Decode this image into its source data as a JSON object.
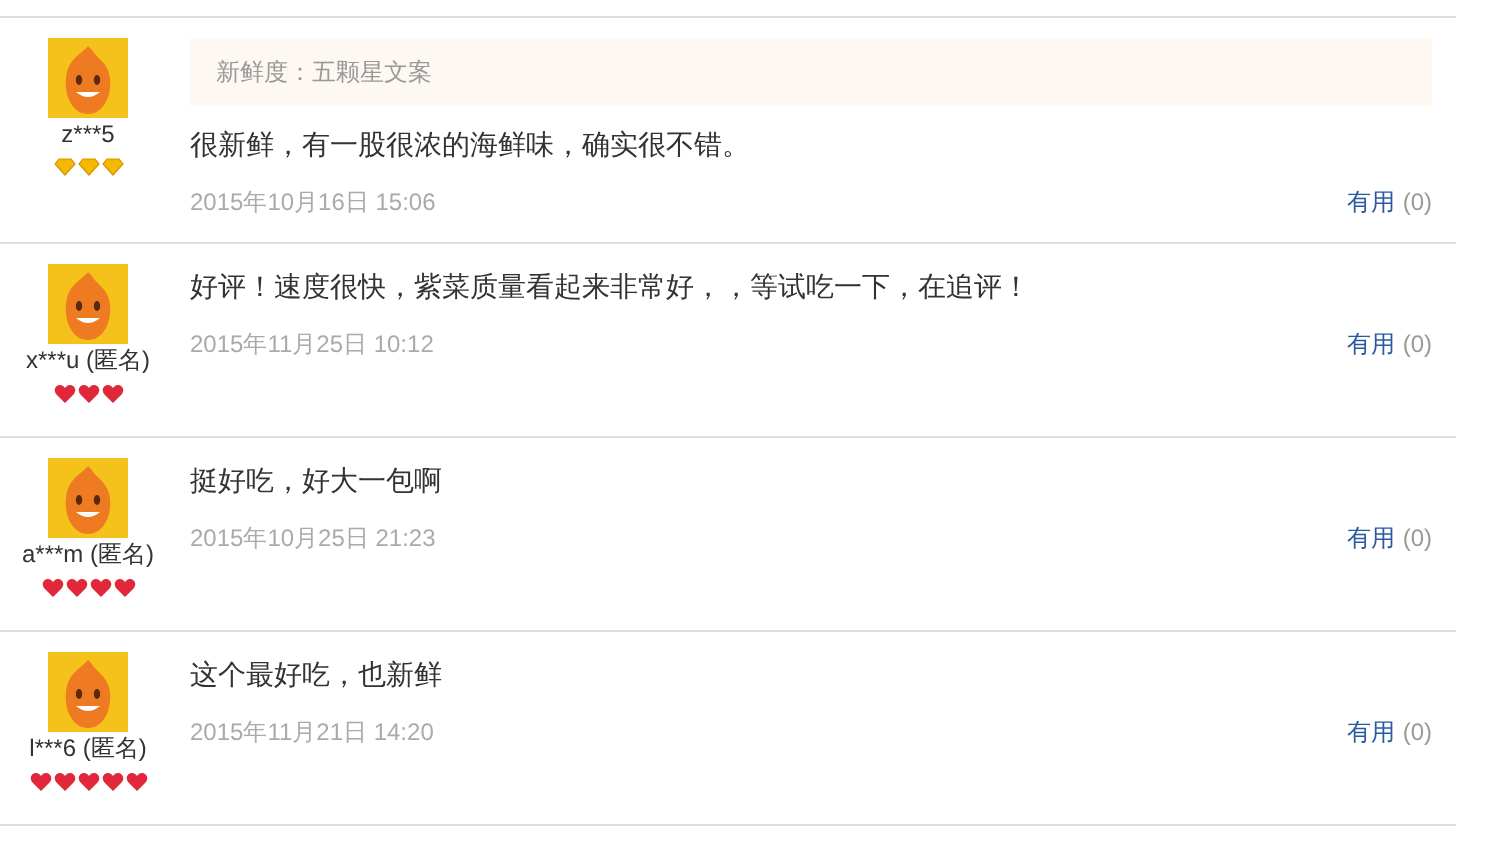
{
  "reviews": [
    {
      "user": "z***5",
      "badge": {
        "kind": "diamond",
        "stars": 3
      },
      "tag": "新鲜度：五颗星文案",
      "text": "很新鲜，有一股很浓的海鲜味，确实很不错。",
      "date": "2015年10月16日 15:06",
      "useful_label": "有用",
      "useful_count": "(0)"
    },
    {
      "user": "x***u (匿名)",
      "badge": {
        "kind": "heart",
        "stars": 3
      },
      "text": "好评！速度很快，紫菜质量看起来非常好，，等试吃一下，在追评！",
      "date": "2015年11月25日 10:12",
      "useful_label": "有用",
      "useful_count": "(0)"
    },
    {
      "user": "a***m (匿名)",
      "badge": {
        "kind": "heart",
        "stars": 4
      },
      "text": "挺好吃，好大一包啊",
      "date": "2015年10月25日 21:23",
      "useful_label": "有用",
      "useful_count": "(0)"
    },
    {
      "user": "l***6 (匿名)",
      "badge": {
        "kind": "heart",
        "stars": 5
      },
      "text": "这个最好吃，也新鲜",
      "date": "2015年11月21日 14:20",
      "useful_label": "有用",
      "useful_count": "(0)"
    }
  ]
}
